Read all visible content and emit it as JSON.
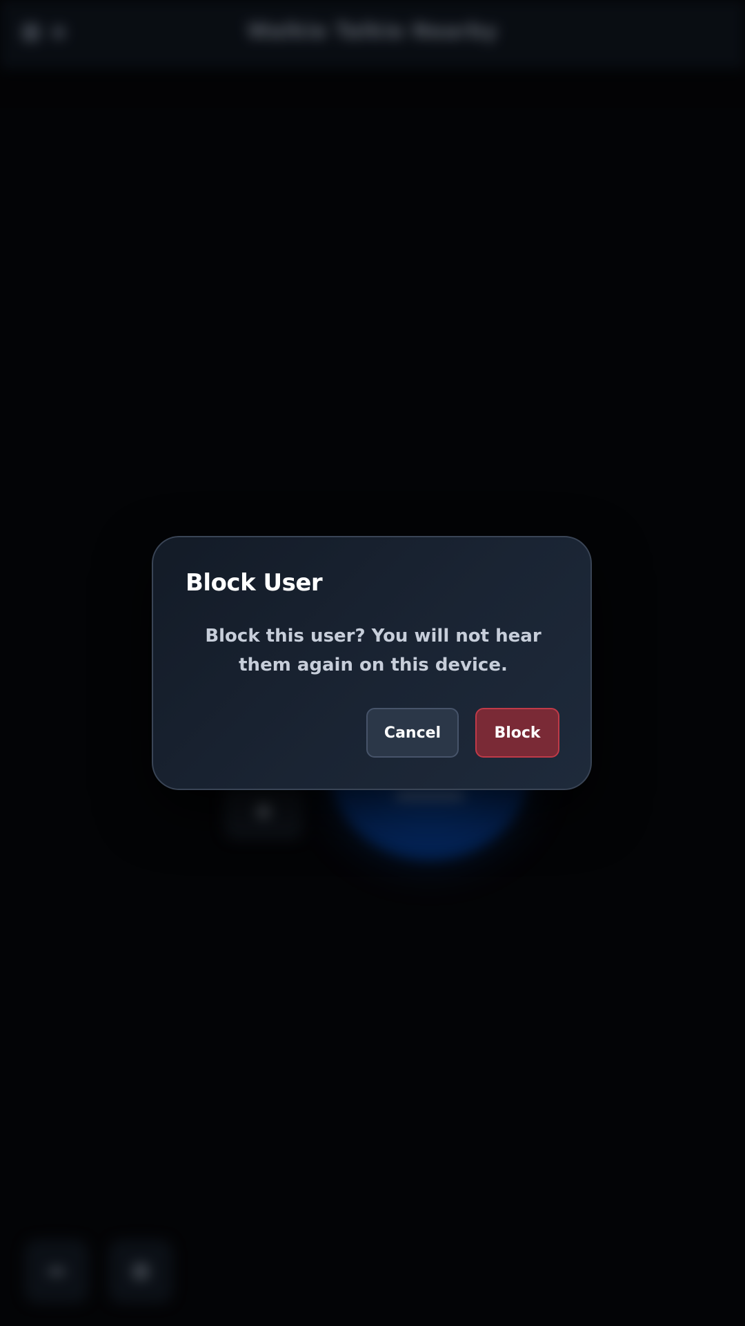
{
  "app": {
    "title": "Walkie Talkie Nearby"
  },
  "dialog": {
    "title": "Block User",
    "message": "Block this user? You will not hear them again on this device.",
    "cancel_label": "Cancel",
    "confirm_label": "Block"
  },
  "colors": {
    "background": "#06070a",
    "dialog_background": "#1a2433",
    "cancel_button": "#2b3748",
    "block_button": "#7a2a36",
    "block_border": "#c03a48",
    "talk_button": "#0a4fb4"
  },
  "icons": {
    "top_left": [
      "settings-icon",
      "info-icon"
    ],
    "bottom_left": [
      "menu-icon",
      "users-icon"
    ]
  }
}
